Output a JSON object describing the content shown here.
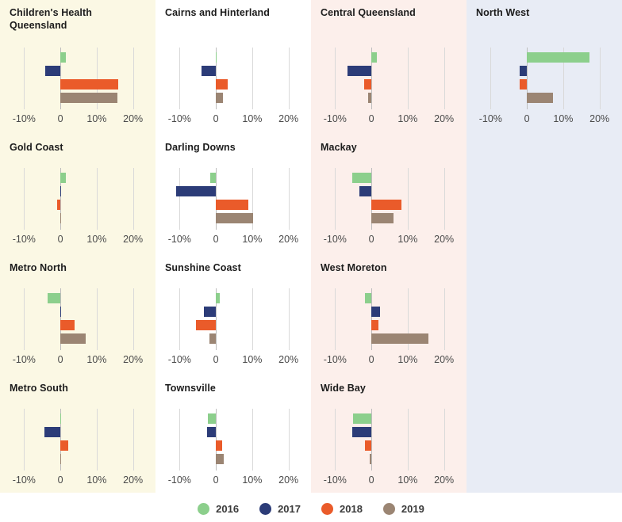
{
  "chart_data": {
    "type": "bar",
    "title": "",
    "orientation": "horizontal",
    "grid": true,
    "legend_position": "bottom",
    "xlabel": "",
    "ylabel": "",
    "xlim": [
      -14.0,
      24.0
    ],
    "xticks": [
      -10,
      0,
      10,
      20
    ],
    "xticklabels": [
      "-10%",
      "0",
      "10%",
      "20%"
    ],
    "series": [
      {
        "name": "2016",
        "color": "#8ccf8c"
      },
      {
        "name": "2017",
        "color": "#2c3c78"
      },
      {
        "name": "2018",
        "color": "#ea5b2a"
      },
      {
        "name": "2019",
        "color": "#9b8573"
      }
    ],
    "panels": [
      {
        "name": "Children's Health Queensland",
        "title_lines": "Children's Health\nQueensland",
        "band": "cream",
        "values": {
          "2016": 1.6,
          "2017": -4.1,
          "2018": 16.0,
          "2019": 15.8
        }
      },
      {
        "name": "Cairns and Hinterland",
        "title_lines": "Cairns and Hinterland",
        "band": "white",
        "values": {
          "2016": 0.0,
          "2017": -4.0,
          "2018": 3.2,
          "2019": 1.9
        }
      },
      {
        "name": "Central Queensland",
        "title_lines": "Central Queensland",
        "band": "pink",
        "values": {
          "2016": 1.4,
          "2017": -6.5,
          "2018": -1.9,
          "2019": -0.9
        }
      },
      {
        "name": "North West",
        "title_lines": "North West",
        "band": "blue",
        "values": {
          "2016": 17.2,
          "2017": -2.0,
          "2018": -2.0,
          "2019": 7.2
        }
      },
      {
        "name": "Gold Coast",
        "title_lines": "Gold Coast",
        "band": "cream",
        "values": {
          "2016": 1.4,
          "2017": 0.0,
          "2018": -0.9,
          "2019": 0.0
        }
      },
      {
        "name": "Darling Downs",
        "title_lines": "Darling Downs",
        "band": "white",
        "values": {
          "2016": -1.6,
          "2017": -11.0,
          "2018": 9.0,
          "2019": 10.2
        }
      },
      {
        "name": "Mackay",
        "title_lines": "Mackay",
        "band": "pink",
        "values": {
          "2016": -5.2,
          "2017": -3.3,
          "2018": 8.2,
          "2019": 6.2
        }
      },
      {
        "name": "Metro North",
        "title_lines": "Metro North",
        "band": "cream",
        "values": {
          "2016": -3.6,
          "2017": 0.1,
          "2018": 4.0,
          "2019": 7.0
        }
      },
      {
        "name": "Sunshine Coast",
        "title_lines": "Sunshine Coast",
        "band": "white",
        "values": {
          "2016": 1.1,
          "2017": -3.4,
          "2018": -5.4,
          "2019": -1.8
        }
      },
      {
        "name": "West Moreton",
        "title_lines": "West Moreton",
        "band": "pink",
        "values": {
          "2016": -1.8,
          "2017": 2.4,
          "2018": 2.0,
          "2019": 15.8
        }
      },
      {
        "name": "Metro South",
        "title_lines": "Metro South",
        "band": "cream",
        "values": {
          "2016": 0.0,
          "2017": -4.3,
          "2018": 2.1,
          "2019": 0.2
        }
      },
      {
        "name": "Townsville",
        "title_lines": "Townsville",
        "band": "white",
        "values": {
          "2016": -2.1,
          "2017": -2.4,
          "2018": 1.8,
          "2019": 2.2
        }
      },
      {
        "name": "Wide Bay",
        "title_lines": "Wide Bay",
        "band": "pink",
        "values": {
          "2016": -5.1,
          "2017": -5.2,
          "2018": -1.7,
          "2019": -0.5
        }
      }
    ]
  },
  "bands": {
    "cream": "#fbf8e4",
    "white": "#ffffff",
    "pink": "#fcefeb",
    "blue": "#e8ecf5"
  },
  "legend": {
    "items": [
      {
        "label": "2016",
        "color": "#8ccf8c"
      },
      {
        "label": "2017",
        "color": "#2c3c78"
      },
      {
        "label": "2018",
        "color": "#ea5b2a"
      },
      {
        "label": "2019",
        "color": "#9b8573"
      }
    ]
  }
}
